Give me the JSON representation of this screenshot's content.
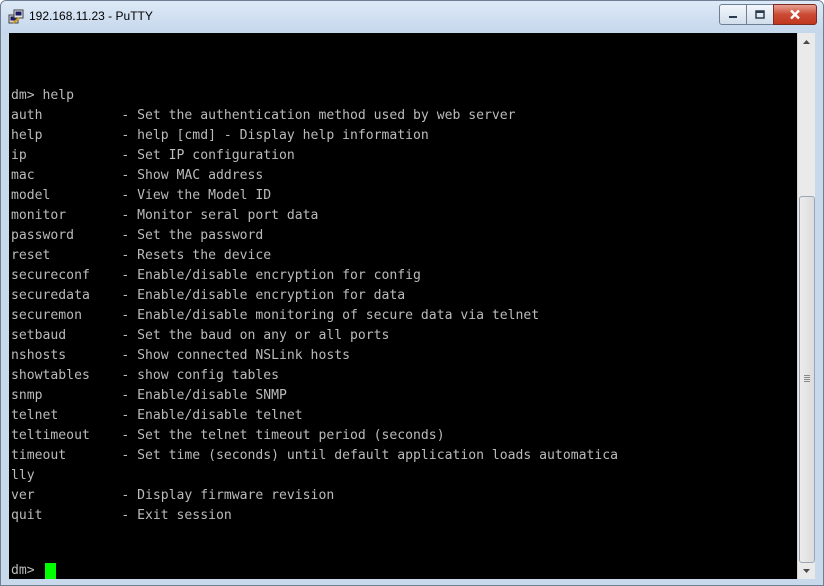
{
  "window": {
    "title": "192.168.11.23 - PuTTY",
    "colors": {
      "terminal_bg": "#000000",
      "terminal_fg": "#bbbbbb",
      "cursor": "#00ff00"
    }
  },
  "terminal": {
    "lines": [
      "dm> help",
      "auth          - Set the authentication method used by web server",
      "help          - help [cmd] - Display help information",
      "ip            - Set IP configuration",
      "mac           - Show MAC address",
      "model         - View the Model ID",
      "monitor       - Monitor seral port data",
      "password      - Set the password",
      "reset         - Resets the device",
      "secureconf    - Enable/disable encryption for config",
      "securedata    - Enable/disable encryption for data",
      "securemon     - Enable/disable monitoring of secure data via telnet",
      "setbaud       - Set the baud on any or all ports",
      "nshosts       - Show connected NSLink hosts",
      "showtables    - show config tables",
      "snmp          - Enable/disable SNMP",
      "telnet        - Enable/disable telnet",
      "teltimeout    - Set the telnet timeout period (seconds)",
      "timeout       - Set time (seconds) until default application loads automatica",
      "lly",
      "ver           - Display firmware revision",
      "quit          - Exit session",
      ""
    ],
    "prompt": "dm> "
  }
}
